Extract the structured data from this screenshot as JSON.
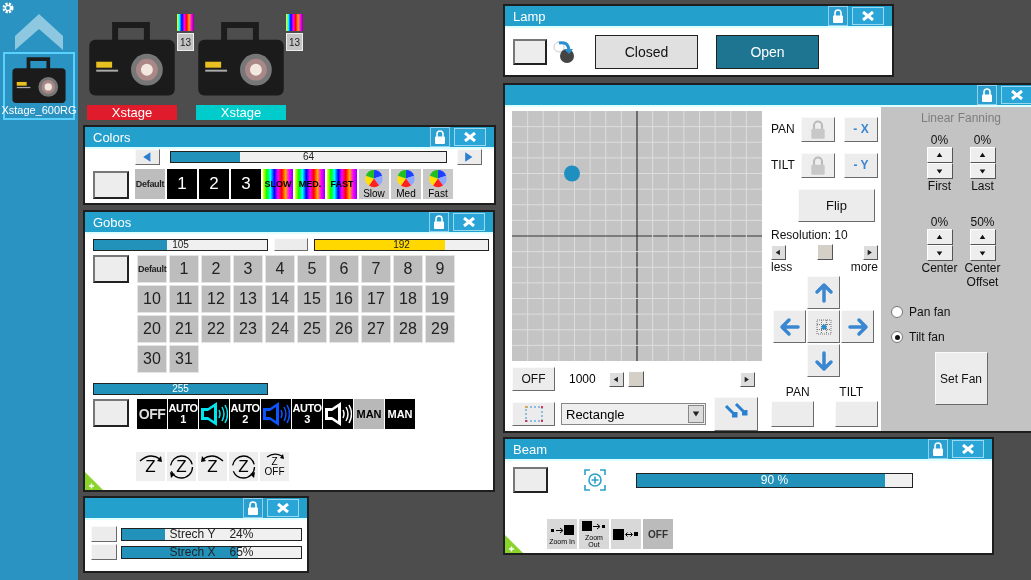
{
  "sidebar": {
    "fixture": {
      "label": "Xstage_600RG",
      "selected": true
    }
  },
  "fixtures": [
    {
      "label": "Xstage",
      "badge": "13",
      "color": "#e01c2c"
    },
    {
      "label": "Xstage",
      "badge": "13",
      "color": "#00cccc"
    }
  ],
  "colors": {
    "title": "Colors",
    "slider": {
      "value": "64",
      "level": 0.25
    },
    "buttons": [
      {
        "kind": "default",
        "label": "Default"
      },
      {
        "kind": "number",
        "label": "1"
      },
      {
        "kind": "number",
        "label": "2"
      },
      {
        "kind": "number",
        "label": "3"
      },
      {
        "kind": "rainbow",
        "label": "SLOW"
      },
      {
        "kind": "rainbow",
        "label": "MED."
      },
      {
        "kind": "rainbow",
        "label": "FAST"
      },
      {
        "kind": "wheel",
        "label": "Slow"
      },
      {
        "kind": "wheel",
        "label": "Med"
      },
      {
        "kind": "wheel",
        "label": "Fast"
      }
    ]
  },
  "gobos": {
    "title": "Gobos",
    "sliders": [
      {
        "value": "105",
        "level": 0.42
      },
      {
        "value": "192",
        "level": 0.75
      }
    ],
    "buttons": [
      {
        "kind": "default",
        "label": "Default"
      },
      {
        "kind": "number",
        "label": "1"
      },
      {
        "kind": "number",
        "label": "2"
      },
      {
        "kind": "number",
        "label": "3"
      },
      {
        "kind": "number",
        "label": "4"
      },
      {
        "kind": "number",
        "label": "5"
      },
      {
        "kind": "number",
        "label": "6"
      },
      {
        "kind": "number",
        "label": "7"
      },
      {
        "kind": "number",
        "label": "8"
      },
      {
        "kind": "number",
        "label": "9"
      },
      {
        "kind": "number",
        "label": "10"
      },
      {
        "kind": "number",
        "label": "11"
      },
      {
        "kind": "number",
        "label": "12"
      },
      {
        "kind": "number",
        "label": "13"
      },
      {
        "kind": "number",
        "label": "14"
      },
      {
        "kind": "number",
        "label": "15"
      },
      {
        "kind": "number",
        "label": "16"
      },
      {
        "kind": "number",
        "label": "17"
      },
      {
        "kind": "number",
        "label": "18"
      },
      {
        "kind": "number",
        "label": "19"
      },
      {
        "kind": "number",
        "label": "20"
      },
      {
        "kind": "number",
        "label": "21"
      },
      {
        "kind": "number",
        "label": "22"
      },
      {
        "kind": "number",
        "label": "23"
      },
      {
        "kind": "number",
        "label": "24"
      },
      {
        "kind": "number",
        "label": "25"
      },
      {
        "kind": "number",
        "label": "26"
      },
      {
        "kind": "number",
        "label": "27"
      },
      {
        "kind": "number",
        "label": "28"
      },
      {
        "kind": "number",
        "label": "29"
      },
      {
        "kind": "number",
        "label": "30"
      },
      {
        "kind": "number",
        "label": "31"
      }
    ],
    "speed": {
      "value": "255",
      "level": 1
    },
    "modes": [
      {
        "kind": "text",
        "label": "OFF",
        "color": "#000000"
      },
      {
        "kind": "auto",
        "label": "AUTO 1"
      },
      {
        "kind": "sound",
        "color": "#00e5ee"
      },
      {
        "kind": "auto",
        "label": "AUTO 2"
      },
      {
        "kind": "sound",
        "color": "#0a55ff"
      },
      {
        "kind": "auto",
        "label": "AUTO 3"
      },
      {
        "kind": "sound",
        "color": "#ffffff"
      },
      {
        "kind": "text",
        "label": "MAN",
        "color": "#b8b8b8"
      },
      {
        "kind": "text",
        "label": "MAN",
        "color": "#000000"
      }
    ],
    "rotations": [
      {
        "kind": "cw",
        "label": "Z"
      },
      {
        "kind": "circle_ccw",
        "label": "Z"
      },
      {
        "kind": "ccw",
        "label": "Z"
      },
      {
        "kind": "circle_cw",
        "label": "Z"
      },
      {
        "kind": "off",
        "label": "Z",
        "off_label": "OFF"
      }
    ]
  },
  "stretch": {
    "sliders": [
      {
        "label": "Strech Y",
        "value": "24%",
        "level": 0.24
      },
      {
        "label": "Strech X",
        "value": "65%",
        "level": 0.65
      }
    ]
  },
  "lamp": {
    "title": "Lamp",
    "buttons": [
      {
        "label": "Closed",
        "selected": false
      },
      {
        "label": "Open",
        "selected": true
      }
    ]
  },
  "position": {
    "pad": {
      "pan": {
        "level": 0.24
      },
      "tilt": {
        "level": 0.25
      }
    },
    "axes": [
      {
        "label": "PAN",
        "invert": "- X"
      },
      {
        "label": "TILT",
        "invert": "- Y"
      }
    ],
    "flip": "Flip",
    "resolution": "Resolution: 10",
    "less": "less",
    "more": "more",
    "channel_labels": [
      "PAN",
      "TILT"
    ],
    "off": "OFF",
    "speed": "1000",
    "shape": "Rectangle",
    "fanning": {
      "title": "Linear Fanning",
      "disabled": true,
      "spinners": [
        {
          "value": "0%"
        },
        {
          "value": "0%"
        },
        {
          "value": "0%"
        },
        {
          "value": "50%"
        }
      ],
      "captions": [
        "First",
        "Last",
        "Center",
        "Center Offset"
      ],
      "modes": [
        {
          "label": "Pan fan",
          "selected": false
        },
        {
          "label": "Tilt fan",
          "selected": true
        }
      ],
      "button": "Set Fan"
    }
  },
  "beam": {
    "title": "Beam",
    "slider": {
      "value": "90 %",
      "level": 0.9
    },
    "buttons": [
      {
        "kind": "zoom_in",
        "label": "Zoom In"
      },
      {
        "kind": "zoom_out",
        "label": "Zoom Out"
      },
      {
        "kind": "swap"
      },
      {
        "kind": "off",
        "label": "OFF"
      }
    ]
  }
}
